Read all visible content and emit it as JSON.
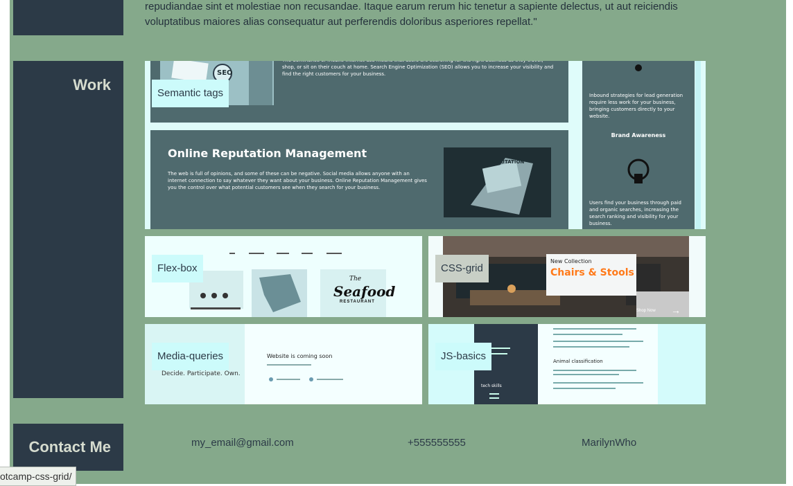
{
  "about": {
    "quote": "repudiandae sint et molestiae non recusandae. Itaque earum rerum hic tenetur a sapiente delectus, ut aut reiciendis voluptatibus maiores alias consequatur aut perferendis doloribus asperiores repellat.\""
  },
  "work": {
    "heading": "Work",
    "projects": [
      {
        "label": "Semantic tags",
        "thumb": {
          "seo_text": "The dominance of mobile Internet use means that users are searching for the right business as they travel, shop, or sit on their couch at home. Search Engine Optimization (SEO) allows you to increase your visibility and find the right customers for your business.",
          "seo_badge": "SEO",
          "orm_title": "Online Reputation Management",
          "orm_text": "The web is full of opinions, and some of these can be negative. Social media allows anyone with an internet connection to say whatever they want about your business. Online Reputation Management gives you the control over what potential customers see when they search for your business.",
          "laptop_screen": "REPUTATION",
          "side_text_1": "Inbound strategies for lead generation require less work for your business, bringing customers directly to your website.",
          "side_heading": "Brand Awareness",
          "side_text_2": "Users find your business through paid and organic searches, increasing the search ranking and visibility for your business."
        }
      },
      {
        "label": "Flex-box",
        "thumb": {
          "logo_top": "The",
          "logo_main": "Seafood",
          "logo_bottom": "RESTAURANT"
        }
      },
      {
        "label": "CSS-grid",
        "thumb": {
          "kicker": "New Collection",
          "title": "Chairs & Stools",
          "cta": "Shop Now"
        }
      },
      {
        "label": "Media-queries",
        "thumb": {
          "slogan": "Decide. Participate. Own.",
          "coming_soon": "Website is coming soon"
        }
      },
      {
        "label": "JS-basics",
        "thumb": {
          "sidebar_heading": "tech skills",
          "link_text": "Animal classification"
        }
      }
    ]
  },
  "contact": {
    "heading": "Contact Me",
    "email": "my_email@gmail.com",
    "phone": "+555555555",
    "handle": "MarilynWho"
  },
  "status_bar": {
    "url": "otcamp-css-grid/"
  },
  "colors": {
    "page_bg": "#85a98b",
    "sidebar_block": "#2c3a47",
    "tag_bg": "#ccfbfb",
    "thumb_teal": "#4f6a6e",
    "accent_orange": "#ff7a1a"
  }
}
